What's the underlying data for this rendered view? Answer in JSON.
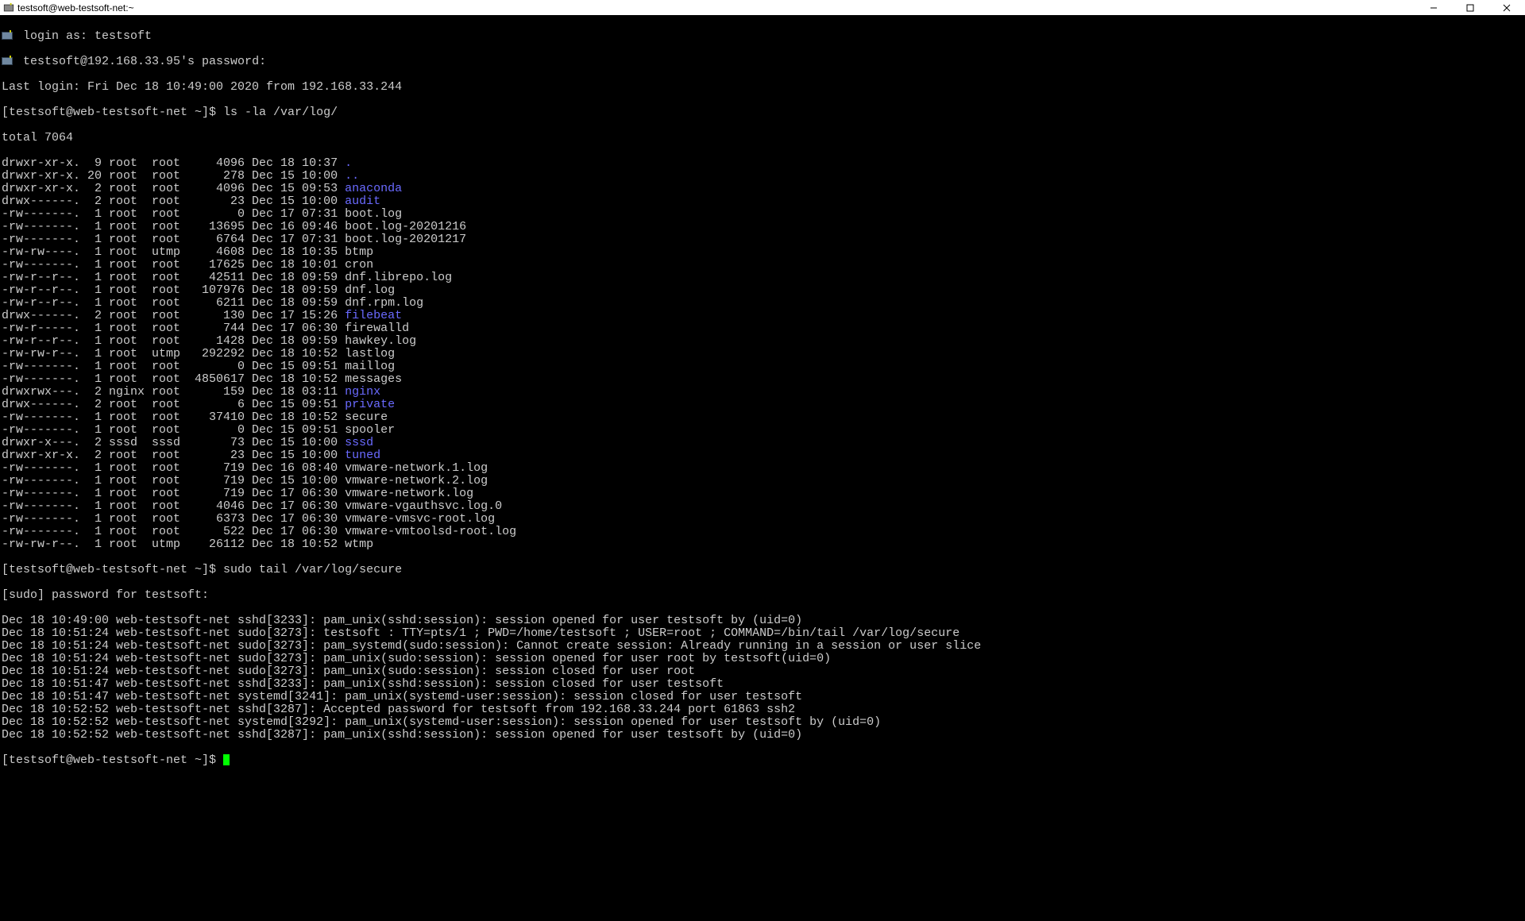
{
  "window": {
    "title": "testsoft@web-testsoft-net:~"
  },
  "login0": "login as: testsoft",
  "login1": "testsoft@192.168.33.95's password:",
  "lastlogin": "Last login: Fri Dec 18 10:49:00 2020 from 192.168.33.244",
  "prompt1_prefix": "[testsoft@web-testsoft-net ~]$ ",
  "cmd1": "ls -la /var/log/",
  "total": "total 7064",
  "ls": [
    {
      "pre": "drwxr-xr-x.  9 root  root     4096 Dec 18 10:37 ",
      "name": ".",
      "dir": true
    },
    {
      "pre": "drwxr-xr-x. 20 root  root      278 Dec 15 10:00 ",
      "name": "..",
      "dir": true
    },
    {
      "pre": "drwxr-xr-x.  2 root  root     4096 Dec 15 09:53 ",
      "name": "anaconda",
      "dir": true
    },
    {
      "pre": "drwx------.  2 root  root       23 Dec 15 10:00 ",
      "name": "audit",
      "dir": true
    },
    {
      "pre": "-rw-------.  1 root  root        0 Dec 17 07:31 ",
      "name": "boot.log",
      "dir": false
    },
    {
      "pre": "-rw-------.  1 root  root    13695 Dec 16 09:46 ",
      "name": "boot.log-20201216",
      "dir": false
    },
    {
      "pre": "-rw-------.  1 root  root     6764 Dec 17 07:31 ",
      "name": "boot.log-20201217",
      "dir": false
    },
    {
      "pre": "-rw-rw----.  1 root  utmp     4608 Dec 18 10:35 ",
      "name": "btmp",
      "dir": false
    },
    {
      "pre": "-rw-------.  1 root  root    17625 Dec 18 10:01 ",
      "name": "cron",
      "dir": false
    },
    {
      "pre": "-rw-r--r--.  1 root  root    42511 Dec 18 09:59 ",
      "name": "dnf.librepo.log",
      "dir": false
    },
    {
      "pre": "-rw-r--r--.  1 root  root   107976 Dec 18 09:59 ",
      "name": "dnf.log",
      "dir": false
    },
    {
      "pre": "-rw-r--r--.  1 root  root     6211 Dec 18 09:59 ",
      "name": "dnf.rpm.log",
      "dir": false
    },
    {
      "pre": "drwx------.  2 root  root      130 Dec 17 15:26 ",
      "name": "filebeat",
      "dir": true
    },
    {
      "pre": "-rw-r-----.  1 root  root      744 Dec 17 06:30 ",
      "name": "firewalld",
      "dir": false
    },
    {
      "pre": "-rw-r--r--.  1 root  root     1428 Dec 18 09:59 ",
      "name": "hawkey.log",
      "dir": false
    },
    {
      "pre": "-rw-rw-r--.  1 root  utmp   292292 Dec 18 10:52 ",
      "name": "lastlog",
      "dir": false
    },
    {
      "pre": "-rw-------.  1 root  root        0 Dec 15 09:51 ",
      "name": "maillog",
      "dir": false
    },
    {
      "pre": "-rw-------.  1 root  root  4850617 Dec 18 10:52 ",
      "name": "messages",
      "dir": false
    },
    {
      "pre": "drwxrwx---.  2 nginx root      159 Dec 18 03:11 ",
      "name": "nginx",
      "dir": true
    },
    {
      "pre": "drwx------.  2 root  root        6 Dec 15 09:51 ",
      "name": "private",
      "dir": true
    },
    {
      "pre": "-rw-------.  1 root  root    37410 Dec 18 10:52 ",
      "name": "secure",
      "dir": false
    },
    {
      "pre": "-rw-------.  1 root  root        0 Dec 15 09:51 ",
      "name": "spooler",
      "dir": false
    },
    {
      "pre": "drwxr-x---.  2 sssd  sssd       73 Dec 15 10:00 ",
      "name": "sssd",
      "dir": true
    },
    {
      "pre": "drwxr-xr-x.  2 root  root       23 Dec 15 10:00 ",
      "name": "tuned",
      "dir": true
    },
    {
      "pre": "-rw-------.  1 root  root      719 Dec 16 08:40 ",
      "name": "vmware-network.1.log",
      "dir": false
    },
    {
      "pre": "-rw-------.  1 root  root      719 Dec 15 10:00 ",
      "name": "vmware-network.2.log",
      "dir": false
    },
    {
      "pre": "-rw-------.  1 root  root      719 Dec 17 06:30 ",
      "name": "vmware-network.log",
      "dir": false
    },
    {
      "pre": "-rw-------.  1 root  root     4046 Dec 17 06:30 ",
      "name": "vmware-vgauthsvc.log.0",
      "dir": false
    },
    {
      "pre": "-rw-------.  1 root  root     6373 Dec 17 06:30 ",
      "name": "vmware-vmsvc-root.log",
      "dir": false
    },
    {
      "pre": "-rw-------.  1 root  root      522 Dec 17 06:30 ",
      "name": "vmware-vmtoolsd-root.log",
      "dir": false
    },
    {
      "pre": "-rw-rw-r--.  1 root  utmp    26112 Dec 18 10:52 ",
      "name": "wtmp",
      "dir": false
    }
  ],
  "cmd2": "sudo tail /var/log/secure",
  "sudo_prompt": "[sudo] password for testsoft:",
  "loglines": [
    "Dec 18 10:49:00 web-testsoft-net sshd[3233]: pam_unix(sshd:session): session opened for user testsoft by (uid=0)",
    "Dec 18 10:51:24 web-testsoft-net sudo[3273]: testsoft : TTY=pts/1 ; PWD=/home/testsoft ; USER=root ; COMMAND=/bin/tail /var/log/secure",
    "Dec 18 10:51:24 web-testsoft-net sudo[3273]: pam_systemd(sudo:session): Cannot create session: Already running in a session or user slice",
    "Dec 18 10:51:24 web-testsoft-net sudo[3273]: pam_unix(sudo:session): session opened for user root by testsoft(uid=0)",
    "Dec 18 10:51:24 web-testsoft-net sudo[3273]: pam_unix(sudo:session): session closed for user root",
    "Dec 18 10:51:47 web-testsoft-net sshd[3233]: pam_unix(sshd:session): session closed for user testsoft",
    "Dec 18 10:51:47 web-testsoft-net systemd[3241]: pam_unix(systemd-user:session): session closed for user testsoft",
    "Dec 18 10:52:52 web-testsoft-net sshd[3287]: Accepted password for testsoft from 192.168.33.244 port 61863 ssh2",
    "Dec 18 10:52:52 web-testsoft-net systemd[3292]: pam_unix(systemd-user:session): session opened for user testsoft by (uid=0)",
    "Dec 18 10:52:52 web-testsoft-net sshd[3287]: pam_unix(sshd:session): session opened for user testsoft by (uid=0)"
  ]
}
